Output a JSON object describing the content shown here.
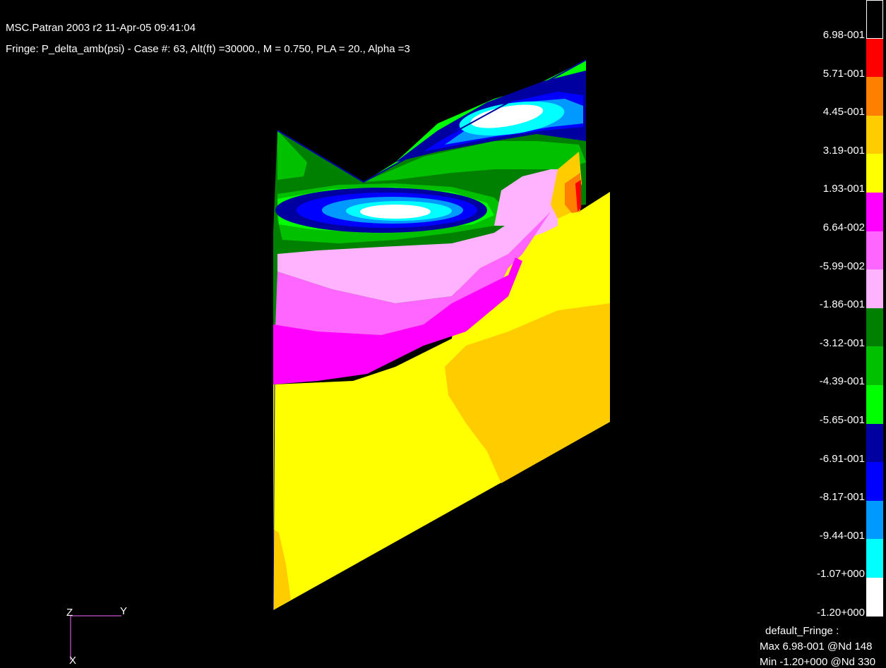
{
  "header": {
    "title": "MSC.Patran 2003 r2 11-Apr-05 09:41:04",
    "fringe": "Fringe: P_delta_amb(psi) - Case #:  63, Alt(ft) =30000., M = 0.750, PLA = 20., Alpha =3"
  },
  "legend": {
    "colors": [
      "#000000",
      "#ff0000",
      "#ff8000",
      "#ffcc00",
      "#ffff00",
      "#ff00ff",
      "#ff66ff",
      "#ffb3ff",
      "#008000",
      "#00c000",
      "#00ff00",
      "#0000a0",
      "#0000ff",
      "#0099ff",
      "#00ffff",
      "#ffffff"
    ],
    "labels": [
      "6.98-001",
      "5.71-001",
      "4.45-001",
      "3.19-001",
      "1.93-001",
      "6.64-002",
      "-5.99-002",
      "-1.86-001",
      "-3.12-001",
      "-4.39-001",
      "-5.65-001",
      "-6.91-001",
      "-8.17-001",
      "-9.44-001",
      "-1.07+000",
      "-1.20+000"
    ]
  },
  "footer": {
    "name": "default_Fringe :",
    "max": "Max 6.98-001 @Nd 148",
    "min": "Min -1.20+000 @Nd 330"
  },
  "triad": {
    "z": "Z",
    "y": "Y",
    "x": "X"
  }
}
